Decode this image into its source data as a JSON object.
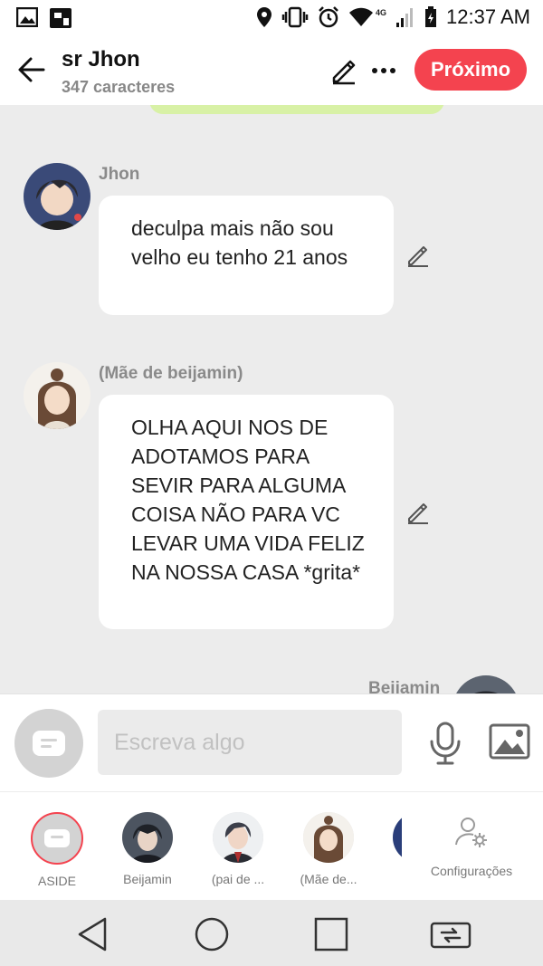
{
  "status": {
    "time": "12:37 AM",
    "network_label": "4G"
  },
  "header": {
    "title": "sr Jhon",
    "subtitle": "347 caracteres",
    "next_label": "Próximo"
  },
  "messages": [
    {
      "speaker": "Jhon",
      "text": "deculpa mais não sou velho eu tenho 21 anos"
    },
    {
      "speaker": "(Mãe de beijamin)",
      "text": "OLHA AQUI NOS DE ADOTAMOS PARA SEVIR PARA ALGUMA COISA NÃO PARA VC LEVAR UMA VIDA FELIZ NA NOSSA CASA *grita*"
    },
    {
      "speaker": "Beijamin"
    }
  ],
  "input": {
    "placeholder": "Escreva algo"
  },
  "characters": [
    {
      "label": "ASIDE"
    },
    {
      "label": "Beijamin"
    },
    {
      "label": "(pai de ..."
    },
    {
      "label": "(Mãe de..."
    }
  ],
  "settings": {
    "label": "Configurações"
  },
  "colors": {
    "accent": "#f4434f",
    "prev_bubble": "#d8f1a6",
    "chat_bg": "#ececec"
  }
}
